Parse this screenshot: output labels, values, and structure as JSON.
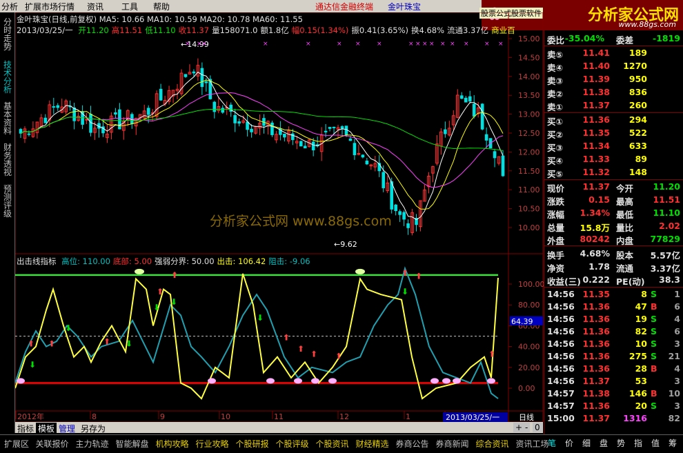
{
  "menubar": {
    "items": [
      "分析",
      "扩展市场行情",
      "资讯",
      "工具",
      "帮助"
    ],
    "brand1": "通达信金融终端",
    "brand2": "金叶珠宝",
    "tag": "股票公式股票软件"
  },
  "logo": {
    "text": "分析家公式网",
    "url": "www.88gs.com"
  },
  "leftnav": [
    "分时走势",
    "技术分析",
    "基本资料",
    "财务透视",
    "预测评级"
  ],
  "chart": {
    "info_line1": "金叶珠宝(日线,前复权) MA5: 10.66  MA10: 10.59  MA20: 10.78  MA60: 11.55",
    "info_line2_date": "2013/03/25/一",
    "info_line2": [
      {
        "t": "开11.20",
        "c": "green"
      },
      {
        "t": "高11.51",
        "c": "red"
      },
      {
        "t": "低11.10",
        "c": "green"
      },
      {
        "t": "收11.37",
        "c": "red"
      },
      {
        "t": "量158071.0",
        "c": "white"
      },
      {
        "t": "额1.8亿",
        "c": "white"
      },
      {
        "t": "幅0.15(1.34%)",
        "c": "red"
      },
      {
        "t": "振0.41(3.65%)",
        "c": "white"
      },
      {
        "t": "换4.68%",
        "c": "white"
      },
      {
        "t": "流通3.37亿",
        "c": "white"
      },
      {
        "t": "商业百",
        "c": "yel"
      }
    ],
    "price_ticks": [
      "15.00",
      "14.50",
      "14.00",
      "13.50",
      "13.00",
      "12.50",
      "12.00",
      "11.50",
      "11.00",
      "10.50",
      "10.00"
    ],
    "high_mark": "14.99",
    "low_mark": "9.62",
    "watermark": "分析家公式网 www.88gs.com",
    "ind_title": "出击线指标",
    "ind_items": [
      {
        "t": "高位: 110.00",
        "c": "cyan"
      },
      {
        "t": "底部: 5.00",
        "c": "red"
      },
      {
        "t": "强弱分界: 50.00",
        "c": "white"
      },
      {
        "t": "出击: 106.42",
        "c": "yel"
      },
      {
        "t": "阻击: -9.06",
        "c": "cyan"
      }
    ],
    "ind_ticks": [
      "100.00",
      "80.00",
      "60.00",
      "40.00",
      "20.00",
      "0.00"
    ],
    "ind_current": "64.39",
    "time_labels": [
      "2012年",
      "8",
      "9",
      "10",
      "11",
      "12",
      "1",
      "2"
    ],
    "date_box": "2013/03/25/一",
    "period": "日线",
    "bottom_tabs": [
      "指标",
      "模板",
      "管理",
      "另存为"
    ],
    "nav_btns": [
      "+",
      "-",
      "0"
    ]
  },
  "footer": [
    "扩展区",
    "关联报价",
    "主力轨迹",
    "智能解盘",
    "机构攻略",
    "行业攻略",
    "个股研报",
    "个股评级",
    "个股资讯",
    "财经精选",
    "券商公告",
    "券商新闻",
    "综合资讯",
    "资讯工场"
  ],
  "quote": {
    "top_row": {
      "label": "委比",
      "value": "-35.04%",
      "label2": "委差",
      "value2": "-1819"
    },
    "sells": [
      {
        "l": "卖⑤",
        "p": "11.41",
        "v": "189"
      },
      {
        "l": "卖④",
        "p": "11.40",
        "v": "1270"
      },
      {
        "l": "卖③",
        "p": "11.39",
        "v": "950"
      },
      {
        "l": "卖②",
        "p": "11.38",
        "v": "836"
      },
      {
        "l": "卖①",
        "p": "11.37",
        "v": "260"
      }
    ],
    "buys": [
      {
        "l": "买①",
        "p": "11.36",
        "v": "294"
      },
      {
        "l": "买②",
        "p": "11.35",
        "v": "522"
      },
      {
        "l": "买③",
        "p": "11.34",
        "v": "633"
      },
      {
        "l": "买④",
        "p": "11.33",
        "v": "89"
      },
      {
        "l": "买⑤",
        "p": "11.32",
        "v": "148"
      }
    ],
    "stats": [
      [
        {
          "t": "现价",
          "c": "white"
        },
        {
          "t": "11.37",
          "c": "red"
        },
        {
          "t": "今开",
          "c": "white"
        },
        {
          "t": "11.20",
          "c": "green"
        }
      ],
      [
        {
          "t": "涨跌",
          "c": "white"
        },
        {
          "t": "0.15",
          "c": "red"
        },
        {
          "t": "最高",
          "c": "white"
        },
        {
          "t": "11.51",
          "c": "red"
        }
      ],
      [
        {
          "t": "涨幅",
          "c": "white"
        },
        {
          "t": "1.34%",
          "c": "red"
        },
        {
          "t": "最低",
          "c": "white"
        },
        {
          "t": "11.10",
          "c": "green"
        }
      ],
      [
        {
          "t": "总量",
          "c": "white"
        },
        {
          "t": "15.8万",
          "c": "yel"
        },
        {
          "t": "量比",
          "c": "white"
        },
        {
          "t": "2.02",
          "c": "red"
        }
      ],
      [
        {
          "t": "外盘",
          "c": "white"
        },
        {
          "t": "80242",
          "c": "red"
        },
        {
          "t": "内盘",
          "c": "white"
        },
        {
          "t": "77829",
          "c": "green"
        }
      ],
      [
        {
          "t": "换手",
          "c": "white"
        },
        {
          "t": "4.68%",
          "c": "white"
        },
        {
          "t": "股本",
          "c": "white"
        },
        {
          "t": "5.57亿",
          "c": "white"
        }
      ],
      [
        {
          "t": "净资",
          "c": "white"
        },
        {
          "t": "1.78",
          "c": "white"
        },
        {
          "t": "流通",
          "c": "white"
        },
        {
          "t": "3.37亿",
          "c": "white"
        }
      ],
      [
        {
          "t": "收益(三)",
          "c": "white"
        },
        {
          "t": "0.222",
          "c": "white"
        },
        {
          "t": "PE(动)",
          "c": "white"
        },
        {
          "t": "38.3",
          "c": "white"
        }
      ]
    ],
    "ticks": [
      {
        "time": "14:56",
        "price": "11.35",
        "vol": "8",
        "bs": "S",
        "n": "1"
      },
      {
        "time": "14:56",
        "price": "11.36",
        "vol": "47",
        "bs": "B",
        "n": "6"
      },
      {
        "time": "14:56",
        "price": "11.36",
        "vol": "19",
        "bs": "S",
        "n": "4"
      },
      {
        "time": "14:56",
        "price": "11.36",
        "vol": "82",
        "bs": "S",
        "n": "6"
      },
      {
        "time": "14:56",
        "price": "11.36",
        "vol": "10",
        "bs": "S",
        "n": "3"
      },
      {
        "time": "14:56",
        "price": "11.36",
        "vol": "275",
        "bs": "S",
        "n": "21"
      },
      {
        "time": "14:56",
        "price": "11.36",
        "vol": "28",
        "bs": "B",
        "n": "4"
      },
      {
        "time": "14:56",
        "price": "11.37",
        "vol": "53",
        "bs": "",
        "n": "3"
      },
      {
        "time": "14:57",
        "price": "11.38",
        "vol": "146",
        "bs": "B",
        "n": "10"
      },
      {
        "time": "14:57",
        "price": "11.36",
        "vol": "20",
        "bs": "S",
        "n": "3"
      },
      {
        "time": "15:00",
        "price": "11.37",
        "vol": "1316",
        "bs": "",
        "n": "82"
      }
    ]
  },
  "right_tabs": [
    "笔",
    "价",
    "细",
    "盘",
    "势",
    "指",
    "值",
    "筹"
  ],
  "colors": {
    "up": "#ff3030",
    "down": "#00e0e0",
    "ma5": "#ffffff",
    "ma10": "#ffff00",
    "ma20": "#ff40ff",
    "ma60": "#00e000",
    "grid": "#800000"
  }
}
